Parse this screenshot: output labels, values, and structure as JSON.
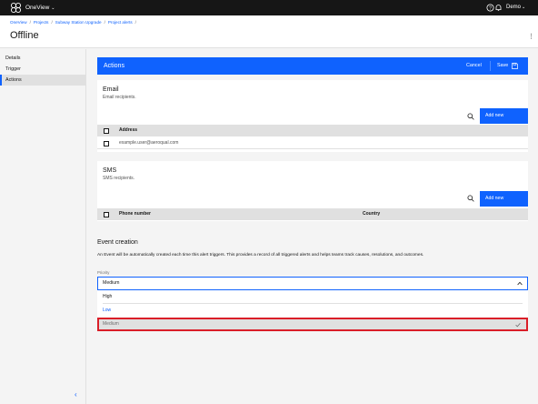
{
  "app": {
    "brand": "OneView",
    "user": "Demo"
  },
  "breadcrumb": [
    "OneView",
    "Projects",
    "Subway Station Upgrade",
    "Project alerts"
  ],
  "page": {
    "title": "Offline"
  },
  "sidebar": {
    "items": [
      {
        "label": "Details",
        "active": false
      },
      {
        "label": "Trigger",
        "active": false
      },
      {
        "label": "Actions",
        "active": true
      }
    ]
  },
  "actions_bar": {
    "title": "Actions",
    "cancel": "Cancel",
    "save": "Save"
  },
  "email": {
    "title": "Email",
    "subtitle": "Email recipients.",
    "add_label": "Add new",
    "columns": [
      "Address"
    ],
    "rows": [
      {
        "address": "example.user@aeroqual.com"
      }
    ]
  },
  "sms": {
    "title": "SMS",
    "subtitle": "SMS recipients.",
    "add_label": "Add new",
    "columns": [
      "Phone number",
      "Country"
    ],
    "rows": []
  },
  "event": {
    "title": "Event creation",
    "description": "An Event will be automatically created each time this alert triggers. This provides a record of all triggered alerts and helps teams track causes, resolutions, and outcomes.",
    "priority_label": "Priority",
    "priority_value": "Medium",
    "options": [
      {
        "label": "High",
        "color": "#161616"
      },
      {
        "label": "Low",
        "color": "#0f62fe"
      },
      {
        "label": "Medium",
        "color": "#6f6f6f",
        "selected": true
      }
    ]
  },
  "colors": {
    "accent": "#0f62fe",
    "topbar": "#161616",
    "highlight": "#da1e28"
  }
}
